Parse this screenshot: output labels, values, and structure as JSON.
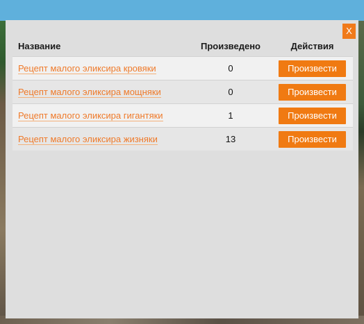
{
  "dialog": {
    "close_label": "X"
  },
  "table": {
    "headers": {
      "name": "Название",
      "produced": "Произведено",
      "actions": "Действия"
    },
    "rows": [
      {
        "name": "Рецепт малого эликсира кровяки",
        "produced": "0",
        "action": "Произвести"
      },
      {
        "name": "Рецепт малого эликсира мощняки",
        "produced": "0",
        "action": "Произвести"
      },
      {
        "name": "Рецепт малого эликсира гигантяки",
        "produced": "1",
        "action": "Произвести"
      },
      {
        "name": "Рецепт малого эликсира жизняки",
        "produced": "13",
        "action": "Произвести"
      }
    ]
  },
  "colors": {
    "accent": "#f07a12",
    "link": "#ef7a2a",
    "panel": "#dedede"
  }
}
